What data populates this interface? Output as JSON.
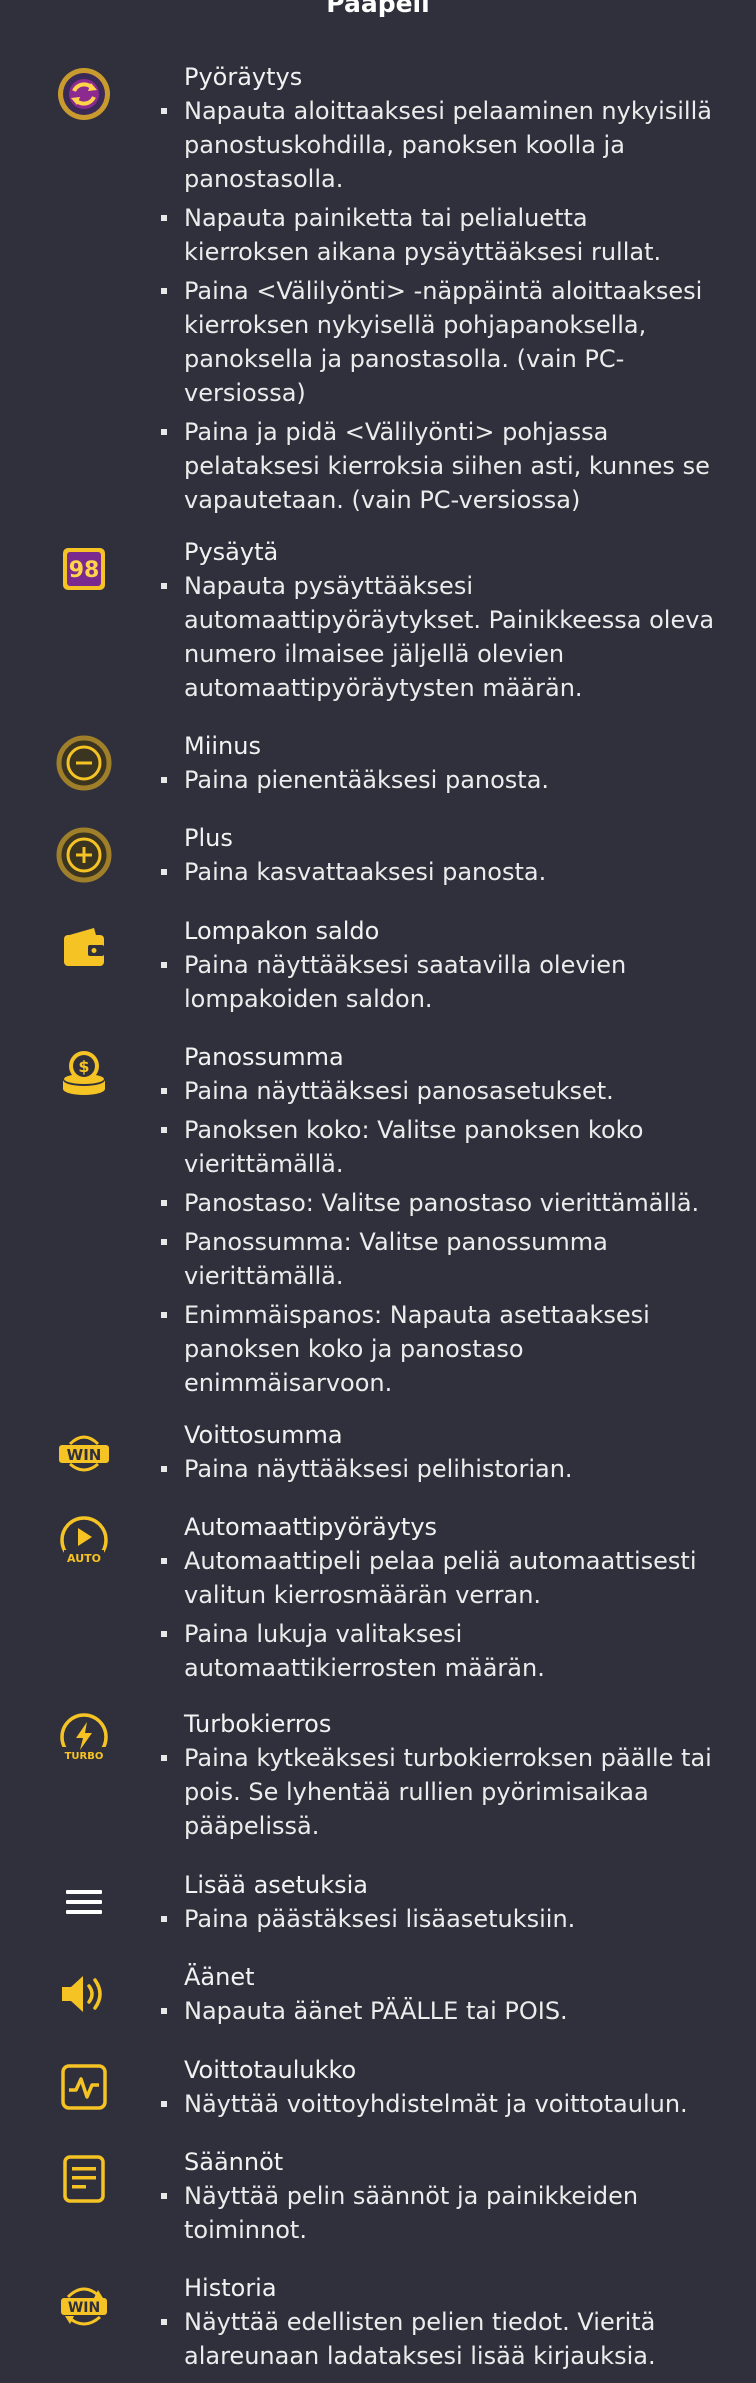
{
  "title": "Pääpeli",
  "items": [
    {
      "heading": "Pyöräytys",
      "icon": "spin-icon",
      "bullets": [
        "Napauta aloittaaksesi pelaaminen nykyisillä panostuskohdilla, panoksen koolla ja panostasolla.",
        "Napauta painiketta tai pelialuetta kierroksen aikana pysäyttääksesi rullat.",
        "Paina <Välilyönti> -näppäintä aloittaaksesi kierroksen nykyisellä pohjapanoksella, panoksella ja panostasolla. (vain PC-versiossa)",
        "Paina ja pidä <Välilyönti> pohjassa pelataksesi kierroksia siihen asti, kunnes se vapautetaan. (vain PC-versiossa)"
      ]
    },
    {
      "heading": "Pysäytä",
      "icon": "stop-autospin-icon",
      "icon_text": "98",
      "bullets": [
        "Napauta pysäyttääksesi automaattipyöräytykset. Painikkeessa oleva numero ilmaisee jäljellä olevien automaattipyöräytysten määrän."
      ]
    },
    {
      "heading": "Miinus",
      "icon": "minus-icon",
      "bullets": [
        "Paina pienentääksesi panosta."
      ]
    },
    {
      "heading": "Plus",
      "icon": "plus-icon",
      "bullets": [
        "Paina kasvattaaksesi panosta."
      ]
    },
    {
      "heading": "Lompakon saldo",
      "icon": "wallet-icon",
      "bullets": [
        "Paina näyttääksesi saatavilla olevien lompakoiden saldon."
      ]
    },
    {
      "heading": "Panossumma",
      "icon": "coin-stack-icon",
      "bullets": [
        "Paina näyttääksesi panosasetukset.",
        "Panoksen koko: Valitse panoksen koko vierittämällä.",
        "Panostaso: Valitse panostaso vierittämällä.",
        "Panossumma: Valitse panossumma vierittämällä.",
        "Enimmäispanos: Napauta asettaaksesi panoksen koko ja panostaso enimmäisarvoon."
      ]
    },
    {
      "heading": "Voittosumma",
      "icon": "win-icon",
      "icon_text": "WIN",
      "bullets": [
        "Paina näyttääksesi pelihistorian."
      ]
    },
    {
      "heading": "Automaattipyöräytys",
      "icon": "autoplay-icon",
      "icon_text": "AUTO",
      "bullets": [
        "Automaattipeli pelaa peliä automaattisesti valitun kierrosmäärän verran.",
        "Paina lukuja valitaksesi automaattikierrosten määrän."
      ]
    },
    {
      "heading": "Turbokierros",
      "icon": "turbo-icon",
      "icon_text": "TURBO",
      "bullets": [
        "Paina kytkeäksesi turbokierroksen päälle tai pois. Se lyhentää rullien pyörimisaikaa pääpelissä."
      ]
    },
    {
      "heading": "Lisää asetuksia",
      "icon": "menu-icon",
      "bullets": [
        "Paina päästäksesi lisäasetuksiin."
      ]
    },
    {
      "heading": "Äänet",
      "icon": "sound-icon",
      "bullets": [
        "Napauta äänet PÄÄLLE tai POIS."
      ]
    },
    {
      "heading": "Voittotaulukko",
      "icon": "paytable-icon",
      "bullets": [
        "Näyttää voittoyhdistelmät ja voittotaulun."
      ]
    },
    {
      "heading": "Säännöt",
      "icon": "rules-icon",
      "bullets": [
        "Näyttää pelin säännöt ja painikkeiden toiminnot."
      ]
    },
    {
      "heading": "Historia",
      "icon": "history-icon",
      "icon_text": "WIN",
      "bullets": [
        "Näyttää edellisten pelien tiedot. Vieritä alareunaan ladataksesi lisää kirjauksia."
      ]
    }
  ],
  "colors": {
    "background": "#30303c",
    "accent": "#f6c324",
    "text": "#f2f2f2"
  }
}
